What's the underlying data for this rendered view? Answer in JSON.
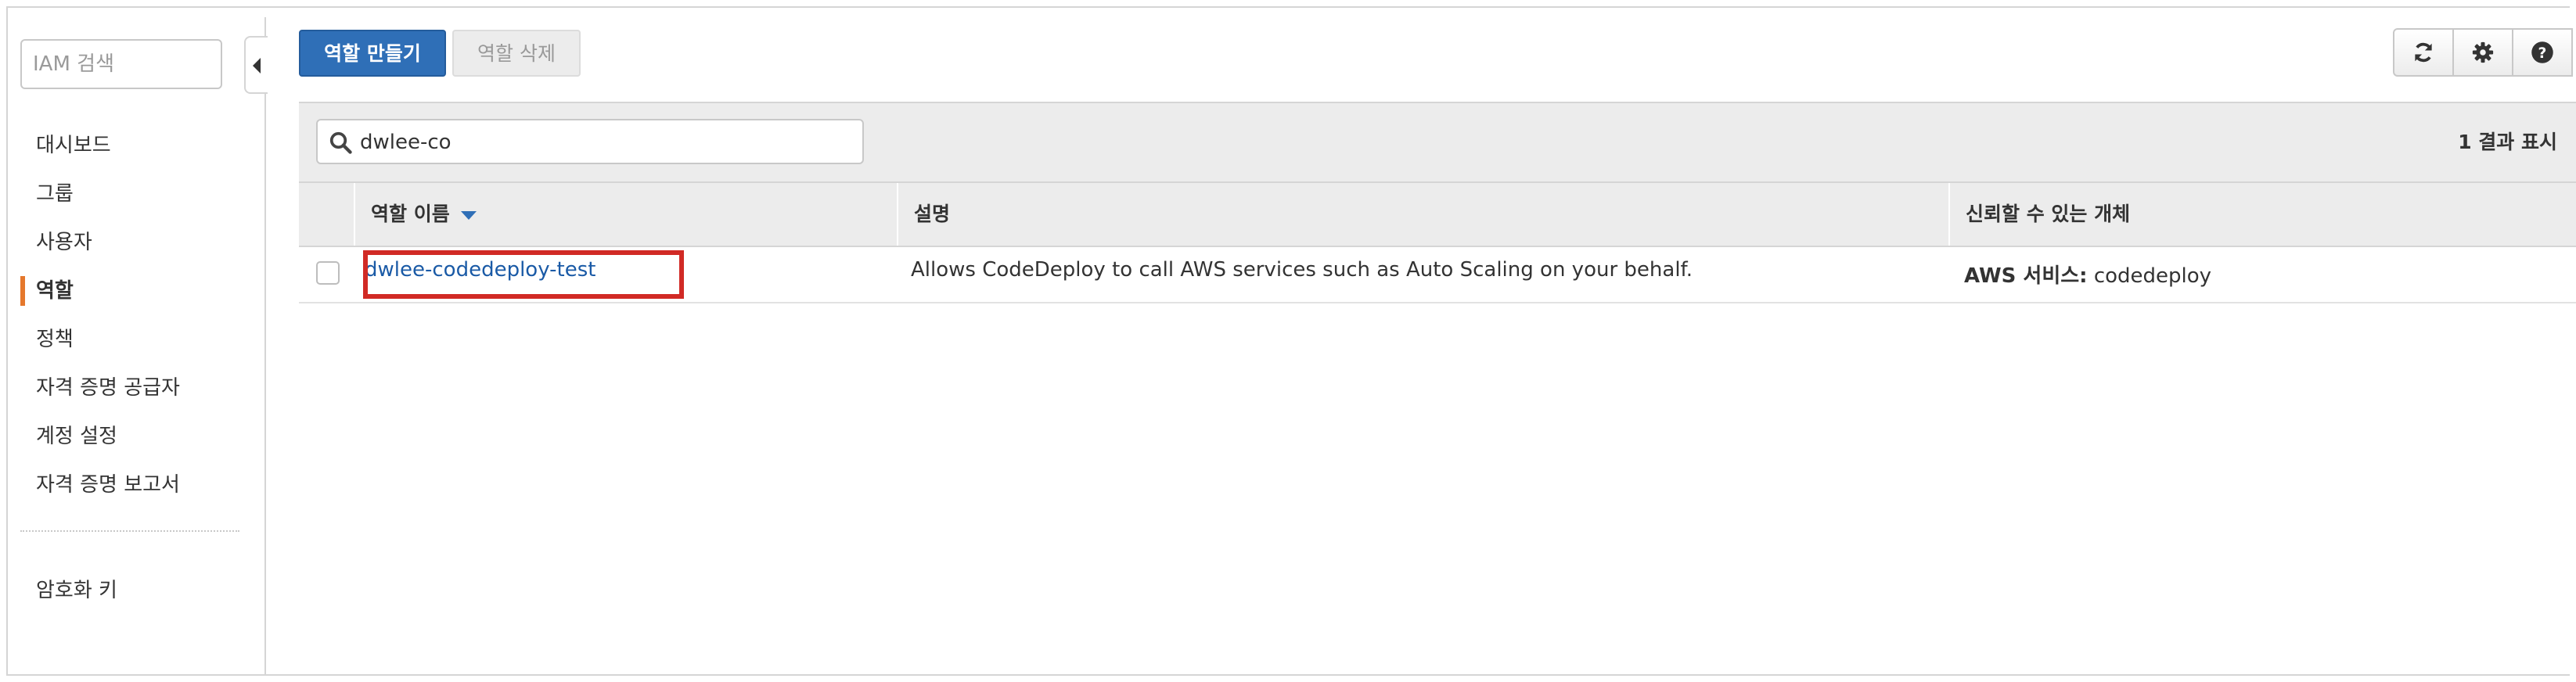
{
  "sidebar": {
    "search_placeholder": "IAM 검색",
    "items": [
      {
        "label": "대시보드"
      },
      {
        "label": "그룹"
      },
      {
        "label": "사용자"
      },
      {
        "label": "역할",
        "active": true
      },
      {
        "label": "정책"
      },
      {
        "label": "자격 증명 공급자"
      },
      {
        "label": "계정 설정"
      },
      {
        "label": "자격 증명 보고서"
      }
    ],
    "bottom_items": [
      {
        "label": "암호화 키"
      }
    ]
  },
  "toolbar": {
    "create_role_label": "역할 만들기",
    "delete_role_label": "역할 삭제",
    "icons": [
      "refresh-icon",
      "gear-icon",
      "help-icon"
    ]
  },
  "filter": {
    "value": "dwlee-co",
    "result_count": "1 결과 표시"
  },
  "table": {
    "columns": {
      "name": "역할 이름",
      "description": "설명",
      "trusted_entities": "신뢰할 수 있는 개체"
    },
    "sort": {
      "column": "name",
      "direction": "descending"
    },
    "rows": [
      {
        "name": "dwlee-codedeploy-test",
        "description": "Allows CodeDeploy to call AWS services such as Auto Scaling on your behalf.",
        "trust_prefix": "AWS 서비스:",
        "trust_value": "codedeploy"
      }
    ]
  },
  "colors": {
    "primary_button": "#2f6fb7",
    "active_nav_marker": "#e5782c",
    "highlight_box": "#d12a25",
    "link": "#1a5aa6"
  }
}
